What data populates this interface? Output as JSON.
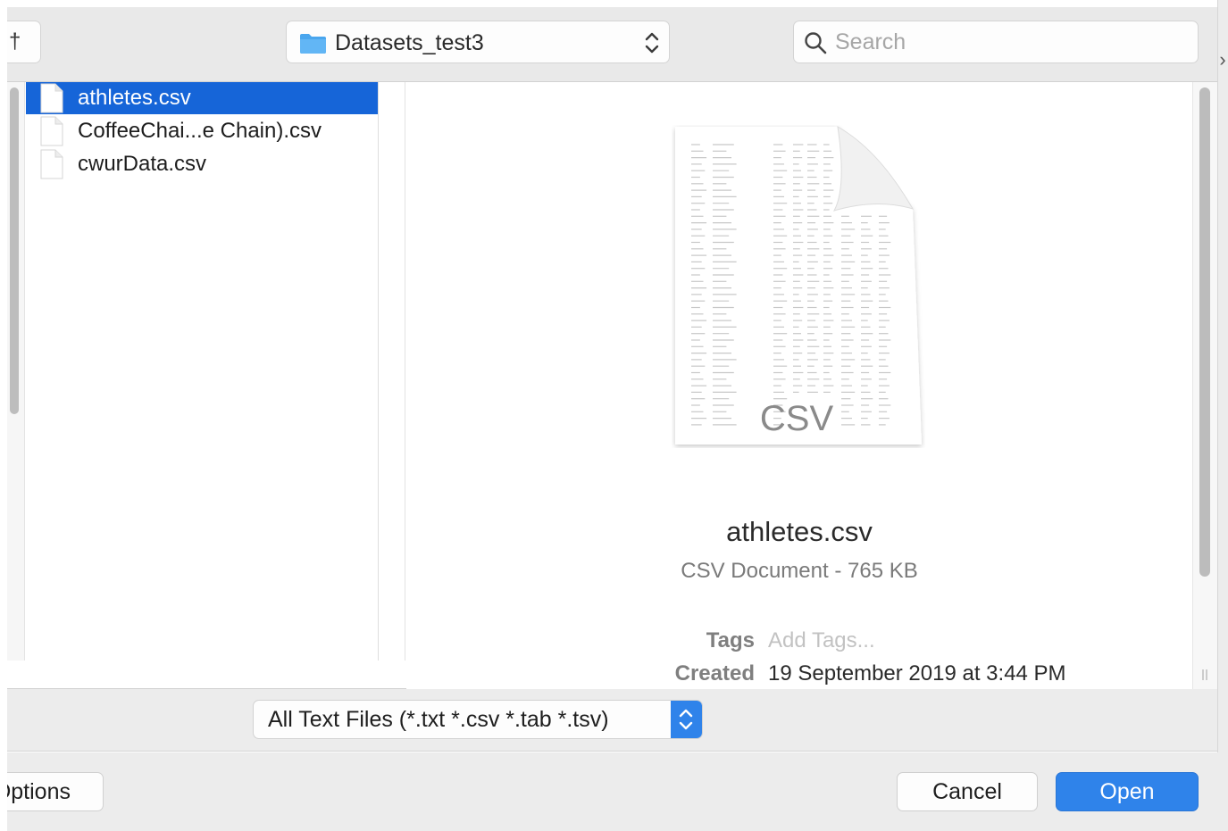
{
  "toolbar": {
    "left_button_glyph": "†",
    "location": "Datasets_test3",
    "search_placeholder": "Search"
  },
  "files": [
    {
      "name": "athletes.csv",
      "selected": true
    },
    {
      "name": "CoffeeChai...e Chain).csv",
      "selected": false
    },
    {
      "name": "cwurData.csv",
      "selected": false
    }
  ],
  "preview": {
    "badge": "CSV",
    "name": "athletes.csv",
    "kind": "CSV Document - 765 KB",
    "tags_label": "Tags",
    "tags_placeholder": "Add Tags...",
    "created_label": "Created",
    "created_value": "19 September 2019 at 3:44 PM"
  },
  "filter": {
    "selected": "All Text Files (*.txt *.csv *.tab *.tsv)"
  },
  "buttons": {
    "options": "Options",
    "cancel": "Cancel",
    "open": "Open"
  },
  "colors": {
    "selection": "#1665d8",
    "accent": "#2f83ea",
    "folder": "#4aa6ee"
  },
  "icons": {
    "location": "folder-icon",
    "location_stepper": "up-down-chevron-icon",
    "search": "search-icon",
    "file": "document-icon",
    "filter_stepper": "up-down-chevron-icon"
  }
}
